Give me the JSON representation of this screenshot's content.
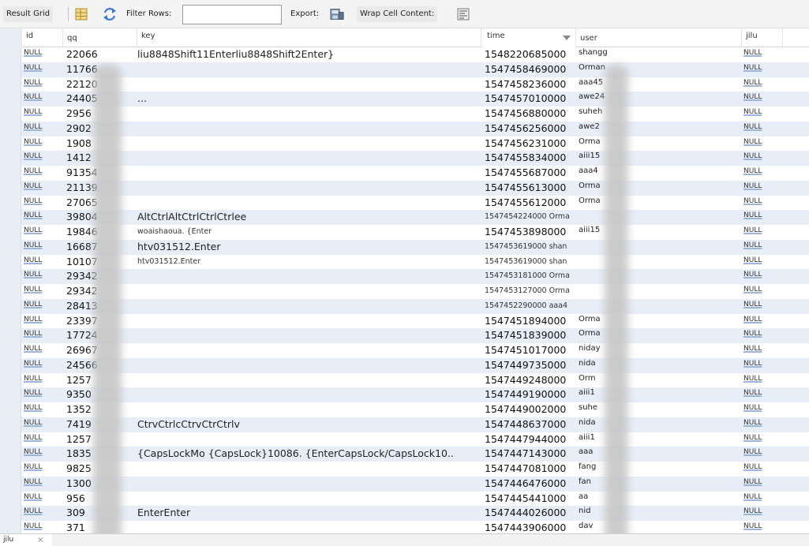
{
  "toolbar": {
    "result_grid": "Result Grid",
    "filter_rows": "Filter Rows:",
    "filter_value": "",
    "export": "Export:",
    "wrap_cell": "Wrap Cell Content:"
  },
  "columns": [
    "id",
    "qq",
    "key",
    "time",
    "user",
    "jilu"
  ],
  "sorted_column": "time",
  "rows": [
    {
      "id": "NULL",
      "qq": "22066",
      "key": "liu8848Shift11Enterliu8848Shift2Enter}",
      "time": "1548220685000",
      "user": "shangg",
      "jilu": "NULL"
    },
    {
      "id": "NULL",
      "qq": "11766",
      "key": "",
      "time": "1547458469000",
      "user": "Orman",
      "jilu": "NULL"
    },
    {
      "id": "NULL",
      "qq": "22120",
      "key": "",
      "time": "1547458236000",
      "user": "aaa45",
      "jilu": "NULL"
    },
    {
      "id": "NULL",
      "qq": "24405",
      "key": "...",
      "time": "1547457010000",
      "user": "awe24",
      "jilu": "NULL"
    },
    {
      "id": "NULL",
      "qq": "2956",
      "key": "",
      "time": "1547456880000",
      "user": "suheh",
      "jilu": "NULL"
    },
    {
      "id": "NULL",
      "qq": "2902",
      "key": "",
      "time": "1547456256000",
      "user": "awe2",
      "jilu": "NULL"
    },
    {
      "id": "NULL",
      "qq": "1908",
      "key": "",
      "time": "1547456231000",
      "user": "Orma",
      "jilu": "NULL"
    },
    {
      "id": "NULL",
      "qq": "1412",
      "key": "",
      "time": "1547455834000",
      "user": "aiii15",
      "jilu": "NULL"
    },
    {
      "id": "NULL",
      "qq": "91354",
      "key": "",
      "time": "1547455687000",
      "user": "aaa4",
      "jilu": "NULL"
    },
    {
      "id": "NULL",
      "qq": "21139",
      "key": "",
      "time": "1547455613000",
      "user": "Orma",
      "jilu": "NULL"
    },
    {
      "id": "NULL",
      "qq": "27065",
      "key": "",
      "time": "1547455612000",
      "user": "Orma",
      "jilu": "NULL"
    },
    {
      "id": "NULL",
      "qq": "39804",
      "key": "AltCtrlAltCtrlCtrlCtrlee",
      "time": "1547454224000 Orma",
      "user": "",
      "jilu": "NULL"
    },
    {
      "id": "NULL",
      "qq": "19846",
      "key": "woaishaoua. {Enter",
      "time": "1547453898000",
      "user": "aiii15",
      "jilu": "NULL"
    },
    {
      "id": "NULL",
      "qq": "16687",
      "key": "htv031512.Enter",
      "time": "1547453619000 shan",
      "user": "",
      "jilu": "NULL"
    },
    {
      "id": "NULL",
      "qq": "10107",
      "key": "htv031512.Enter",
      "time": "1547453619000 shan",
      "user": "",
      "jilu": "NULL"
    },
    {
      "id": "NULL",
      "qq": "29342",
      "key": "",
      "time": "1547453181000 Orma",
      "user": "",
      "jilu": "NULL"
    },
    {
      "id": "NULL",
      "qq": "29342",
      "key": "",
      "time": "1547453127000 Orma",
      "user": "",
      "jilu": "NULL"
    },
    {
      "id": "NULL",
      "qq": "28413",
      "key": "",
      "time": "1547452290000 aaa4",
      "user": "",
      "jilu": "NULL"
    },
    {
      "id": "NULL",
      "qq": "23397",
      "key": "",
      "time": "1547451894000",
      "user": "Orma",
      "jilu": "NULL"
    },
    {
      "id": "NULL",
      "qq": "17724",
      "key": "",
      "time": "1547451839000",
      "user": "Orma",
      "jilu": "NULL"
    },
    {
      "id": "NULL",
      "qq": "26967",
      "key": "",
      "time": "1547451017000",
      "user": "niday",
      "jilu": "NULL"
    },
    {
      "id": "NULL",
      "qq": "24566",
      "key": "",
      "time": "1547449735000",
      "user": "nida",
      "jilu": "NULL"
    },
    {
      "id": "NULL",
      "qq": "1257",
      "key": "",
      "time": "1547449248000",
      "user": "Orm",
      "jilu": "NULL"
    },
    {
      "id": "NULL",
      "qq": "9350",
      "key": "",
      "time": "1547449190000",
      "user": "aiii1",
      "jilu": "NULL"
    },
    {
      "id": "NULL",
      "qq": "1352",
      "key": "",
      "time": "1547449002000",
      "user": "suhe",
      "jilu": "NULL"
    },
    {
      "id": "NULL",
      "qq": "7419",
      "key": "CtrvCtrlcCtrvCtrCtrlv",
      "time": "1547448637000",
      "user": "nida",
      "jilu": "NULL"
    },
    {
      "id": "NULL",
      "qq": "1257",
      "key": "",
      "time": "1547447944000",
      "user": "aiii1",
      "jilu": "NULL"
    },
    {
      "id": "NULL",
      "qq": "1835",
      "key": "{CapsLockMo {CapsLock}10086. {EnterCapsLock/CapsLock10..",
      "time": "1547447143000",
      "user": "aaa",
      "jilu": "NULL"
    },
    {
      "id": "NULL",
      "qq": "9825",
      "key": "",
      "time": "1547447081000",
      "user": "fang",
      "jilu": "NULL"
    },
    {
      "id": "NULL",
      "qq": "1300",
      "key": "",
      "time": "1547446476000",
      "user": "fan",
      "jilu": "NULL"
    },
    {
      "id": "NULL",
      "qq": "956",
      "key": "",
      "time": "1547445441000",
      "user": "aa",
      "jilu": "NULL"
    },
    {
      "id": "NULL",
      "qq": "309",
      "key": "EnterEnter",
      "time": "1547444026000",
      "user": "nid",
      "jilu": "NULL"
    },
    {
      "id": "NULL",
      "qq": "371",
      "key": "",
      "time": "1547443906000",
      "user": "dav",
      "jilu": "NULL"
    }
  ],
  "status": {
    "tab_label": "jilu",
    "tab_close": "×"
  },
  "colors": {
    "row_alt": "#e8eef8",
    "gutter": "#e9eef6",
    "toolbar": "#f4f4f4"
  }
}
